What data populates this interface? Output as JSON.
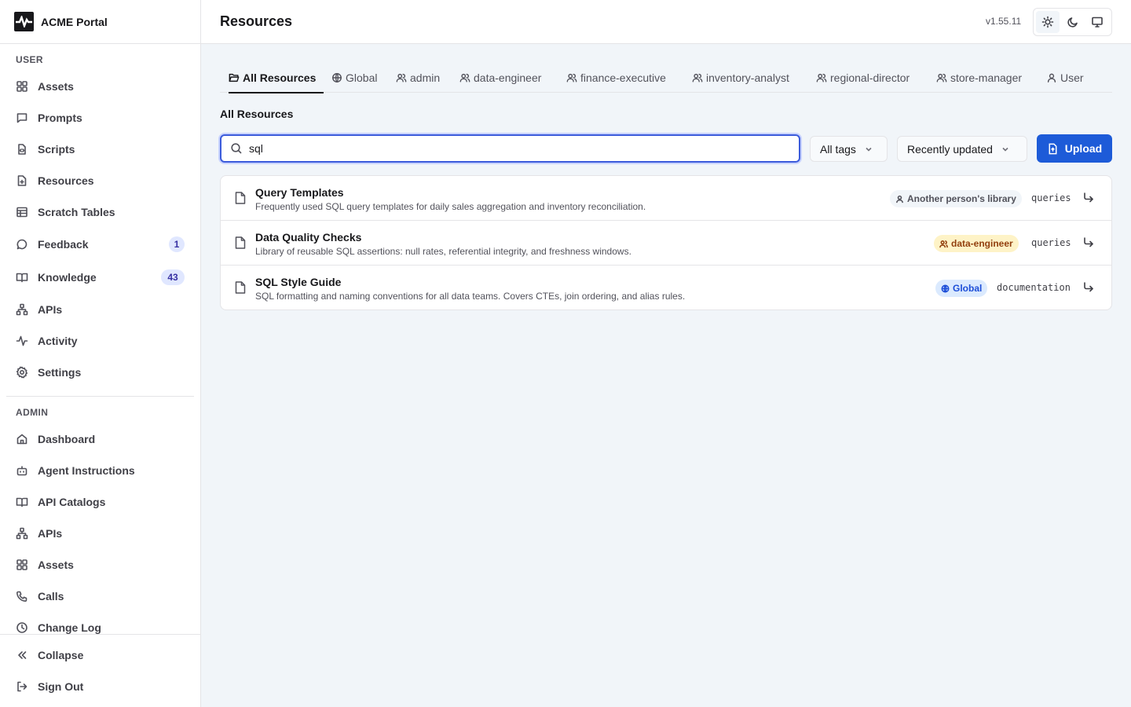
{
  "app": {
    "name": "ACME Portal",
    "version": "v1.55.11"
  },
  "sidebar": {
    "user_section_label": "USER",
    "admin_section_label": "ADMIN",
    "user_items": [
      {
        "label": "Assets",
        "icon": "grid-icon"
      },
      {
        "label": "Prompts",
        "icon": "message-square-icon"
      },
      {
        "label": "Scripts",
        "icon": "file-code-icon"
      },
      {
        "label": "Resources",
        "icon": "file-plus-icon"
      },
      {
        "label": "Scratch Tables",
        "icon": "table-icon"
      },
      {
        "label": "Feedback",
        "icon": "message-circle-icon",
        "badge": "1"
      },
      {
        "label": "Knowledge",
        "icon": "book-open-icon",
        "badge": "43"
      },
      {
        "label": "APIs",
        "icon": "network-icon"
      },
      {
        "label": "Activity",
        "icon": "activity-icon"
      },
      {
        "label": "Settings",
        "icon": "gear-icon"
      }
    ],
    "admin_items": [
      {
        "label": "Dashboard",
        "icon": "home-icon"
      },
      {
        "label": "Agent Instructions",
        "icon": "bot-icon"
      },
      {
        "label": "API Catalogs",
        "icon": "book-open-icon"
      },
      {
        "label": "APIs",
        "icon": "network-icon"
      },
      {
        "label": "Assets",
        "icon": "grid-icon"
      },
      {
        "label": "Calls",
        "icon": "phone-icon"
      },
      {
        "label": "Change Log",
        "icon": "clock-icon"
      }
    ],
    "collapse_label": "Collapse",
    "sign_out_label": "Sign Out"
  },
  "header": {
    "title": "Resources"
  },
  "tabs": [
    {
      "label": "All Resources",
      "icon": "folder-open-icon",
      "active": true
    },
    {
      "label": "Global",
      "icon": "globe-icon"
    },
    {
      "label": "admin",
      "icon": "users-icon"
    },
    {
      "label": "data-engineer",
      "icon": "users-icon"
    },
    {
      "label": "finance-executive",
      "icon": "users-icon"
    },
    {
      "label": "inventory-analyst",
      "icon": "users-icon"
    },
    {
      "label": "regional-director",
      "icon": "users-icon"
    },
    {
      "label": "store-manager",
      "icon": "users-icon"
    },
    {
      "label": "User",
      "icon": "user-icon"
    }
  ],
  "list_title": "All Resources",
  "search": {
    "value": "sql",
    "placeholder": ""
  },
  "filters": {
    "tags_label": "All tags",
    "sort_label": "Recently updated"
  },
  "upload_label": "Upload",
  "resources": [
    {
      "name": "Query Templates",
      "description": "Frequently used SQL query templates for daily sales aggregation and inventory reconciliation.",
      "owner": "Another person's library",
      "owner_style": "gray",
      "tag": "queries"
    },
    {
      "name": "Data Quality Checks",
      "description": "Library of reusable SQL assertions: null rates, referential integrity, and freshness windows.",
      "owner": "data-engineer",
      "owner_style": "amber",
      "tag": "queries"
    },
    {
      "name": "SQL Style Guide",
      "description": "SQL formatting and naming conventions for all data teams. Covers CTEs, join ordering, and alias rules.",
      "owner": "Global",
      "owner_style": "blue",
      "tag": "documentation"
    }
  ],
  "colors": {
    "accent": "#1d5bd8",
    "focus_ring": "#3b5bdb",
    "badge_bg": "#e0e7ff",
    "amber_pill": "#fef3c7",
    "blue_pill": "#dbeafe"
  }
}
